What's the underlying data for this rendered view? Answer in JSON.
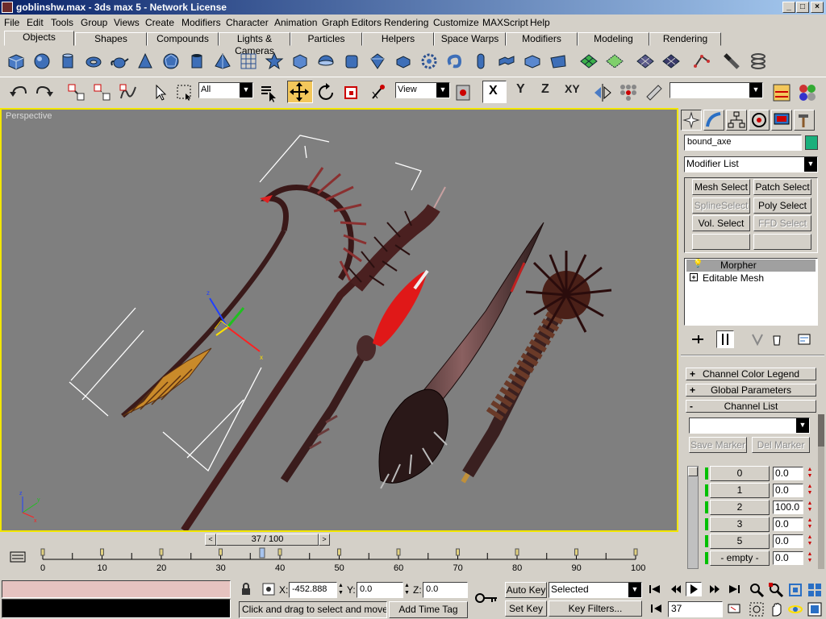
{
  "window": {
    "title": "goblinshw.max - 3ds max 5 - Network License"
  },
  "menu": [
    "File",
    "Edit",
    "Tools",
    "Group",
    "Views",
    "Create",
    "Modifiers",
    "Character",
    "Animation",
    "Graph Editors",
    "Rendering",
    "Customize",
    "MAXScript",
    "Help"
  ],
  "tabs": [
    "Objects",
    "Shapes",
    "Compounds",
    "Lights & Cameras",
    "Particles",
    "Helpers",
    "Space Warps",
    "Modifiers",
    "Modeling",
    "Rendering"
  ],
  "active_tab": "Objects",
  "main_toolbar": {
    "selection_filter": "All",
    "reference_coord": "View",
    "axis_x": "X",
    "axis_y": "Y",
    "axis_z": "Z",
    "axis_xy": "XY"
  },
  "viewport": {
    "label": "Perspective",
    "gizmo_x": "x",
    "gizmo_y": "y",
    "gizmo_z": "z"
  },
  "command_panel": {
    "object_name": "bound_axe",
    "object_color": "#1ab07c",
    "modifier_list": "Modifier List",
    "quick_buttons": [
      "Mesh Select",
      "Patch Select",
      "SplineSelect",
      "Poly Select",
      "Vol. Select",
      "FFD Select"
    ],
    "stack": [
      {
        "label": "Morpher",
        "selected": true
      },
      {
        "label": "Editable Mesh",
        "selected": false
      }
    ],
    "rollouts": [
      {
        "sign": "+",
        "label": "Channel Color Legend"
      },
      {
        "sign": "+",
        "label": "Global Parameters"
      },
      {
        "sign": "-",
        "label": "Channel List"
      }
    ],
    "save_marker": "Save Marker",
    "del_marker": "Del Marker",
    "channels": [
      {
        "name": "0",
        "value": "0.0"
      },
      {
        "name": "1",
        "value": "0.0"
      },
      {
        "name": "2",
        "value": "100.0"
      },
      {
        "name": "3",
        "value": "0.0"
      },
      {
        "name": "5",
        "value": "0.0"
      },
      {
        "name": "- empty -",
        "value": "0.0"
      }
    ]
  },
  "time_slider": {
    "label": "37 / 100",
    "position": 37,
    "end": 100
  },
  "trackbar_ticks": [
    "0",
    "10",
    "20",
    "30",
    "40",
    "50",
    "60",
    "70",
    "80",
    "90",
    "100"
  ],
  "status": {
    "x_label": "X:",
    "x": "-452.888",
    "y_label": "Y:",
    "y": "0.0",
    "z_label": "Z:",
    "z": "0.0",
    "prompt": "Click and drag to select and move obj",
    "add_time_tag": "Add Time Tag",
    "auto_key": "Auto Key",
    "set_key": "Set Key",
    "key_mode": "Selected",
    "key_filters": "Key Filters...",
    "current_frame": "37"
  }
}
